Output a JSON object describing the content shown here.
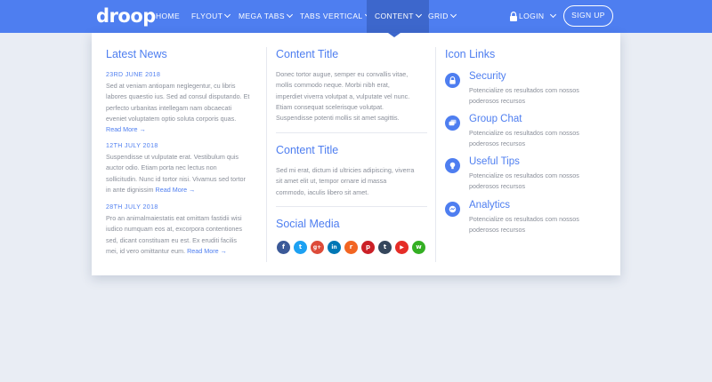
{
  "navbar": {
    "logo": "droop",
    "items": [
      "HOME",
      "FLYOUT",
      "MEGA TABS",
      "TABS VERTICAL",
      "CONTENT",
      "GRID"
    ],
    "login": "LOGIN",
    "signup": "SIGN UP",
    "accent": "#4e7ef0"
  },
  "news": {
    "title": "Latest News",
    "read_more": "Read More",
    "items": [
      {
        "date": "23RD JUNE 2018",
        "lines": [
          "Sed at veniam antiopam neglegentur, cu libris",
          "labores quaestio ius. Sed ad consul disputando. Et",
          "perfecto urbanitas intellegam nam obcaecati",
          "eveniet voluptatem optio soluta corporis quas."
        ]
      },
      {
        "date": "12TH JULY 2018",
        "lines": [
          "Suspendisse ut vulputate erat. Vestibulum quis",
          "auctor odio. Etiam porta nec lectus non",
          "sollicitudin. Nunc id tortor nisi. Vivamus sed tortor",
          "in ante dignissim"
        ]
      },
      {
        "date": "28TH JULY 2018",
        "lines": [
          "Pro an animalmaiestatis eat omittam fastidii wisi",
          "iudico numquam eos at, excorpora contentiones",
          "sed, dicant constituam eu est. Ex eruditi facilis",
          "mei, id vero omittantur eum."
        ]
      }
    ]
  },
  "content": {
    "block1": {
      "title": "Content Title",
      "lines": [
        "Donec tortor augue, semper eu convallis vitae,",
        "mollis commodo neque. Morbi nibh erat,",
        "imperdiet viverra volutpat a, vulputate vel nunc.",
        "Etiam consequat scelerisque volutpat.",
        "Suspendisse potenti mollis sit amet sagittis."
      ]
    },
    "block2": {
      "title": "Content Title",
      "lines": [
        "Sed mi erat, dictum id ultricies adipiscing, viverra",
        "sit amet elit ut, tempor ornare id massa",
        "commodo, iaculis libero sit amet."
      ]
    },
    "social_title": "Social Media",
    "social": [
      {
        "name": "facebook-icon",
        "glyph": "f",
        "color": "#3b5998"
      },
      {
        "name": "twitter-icon",
        "glyph": "t",
        "color": "#1da1f2"
      },
      {
        "name": "google-plus-icon",
        "glyph": "g+",
        "color": "#dd4b39"
      },
      {
        "name": "linkedin-icon",
        "glyph": "in",
        "color": "#0077b5"
      },
      {
        "name": "rss-icon",
        "glyph": "r",
        "color": "#f26522"
      },
      {
        "name": "pinterest-icon",
        "glyph": "p",
        "color": "#cb2027"
      },
      {
        "name": "tumblr-icon",
        "glyph": "t",
        "color": "#35465c"
      },
      {
        "name": "youtube-icon",
        "glyph": "▶",
        "color": "#e52d27"
      },
      {
        "name": "whatsapp-icon",
        "glyph": "w",
        "color": "#34af23"
      }
    ]
  },
  "icon_links": {
    "title": "Icon Links",
    "items": [
      {
        "title": "Security",
        "icon": "lock-icon",
        "desc": "Potencialize os resultados com nossos poderosos recursos"
      },
      {
        "title": "Group Chat",
        "icon": "chat-icon",
        "desc": "Potencialize os resultados com nossos poderosos recursos"
      },
      {
        "title": "Useful Tips",
        "icon": "lightbulb-icon",
        "desc": "Potencialize os resultados com nossos poderosos recursos"
      },
      {
        "title": "Analytics",
        "icon": "analytics-icon",
        "desc": "Potencialize os resultados com nossos poderosos recursos"
      }
    ]
  }
}
